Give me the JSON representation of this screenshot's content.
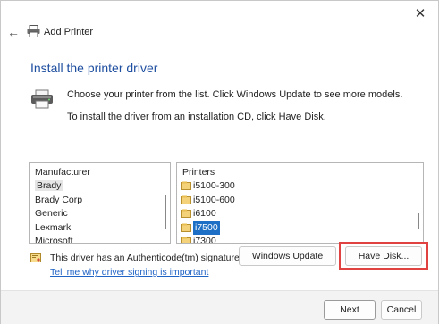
{
  "window": {
    "title": "Add Printer",
    "close_glyph": "✕",
    "back_glyph": "←"
  },
  "content": {
    "heading": "Install the printer driver",
    "instruction1": "Choose your printer from the list. Click Windows Update to see more models.",
    "instruction2": "To install the driver from an installation CD, click Have Disk."
  },
  "manufacturer_list": {
    "header": "Manufacturer",
    "items": [
      "Brady",
      "Brady Corp",
      "Generic",
      "Lexmark",
      "Microsoft"
    ],
    "selected_index": 0
  },
  "printer_list": {
    "header": "Printers",
    "items": [
      "i5100-300",
      "i5100-600",
      "i6100",
      "i7500",
      "i7300"
    ],
    "selected_index": 3
  },
  "signature": {
    "text": "This driver has an Authenticode(tm) signature.",
    "link": "Tell me why driver signing is important"
  },
  "buttons": {
    "windows_update": "Windows Update",
    "have_disk": "Have Disk...",
    "next": "Next",
    "cancel": "Cancel"
  },
  "colors": {
    "accent": "#1d6fc5",
    "heading": "#1f4fa0",
    "highlight": "#e04141"
  }
}
